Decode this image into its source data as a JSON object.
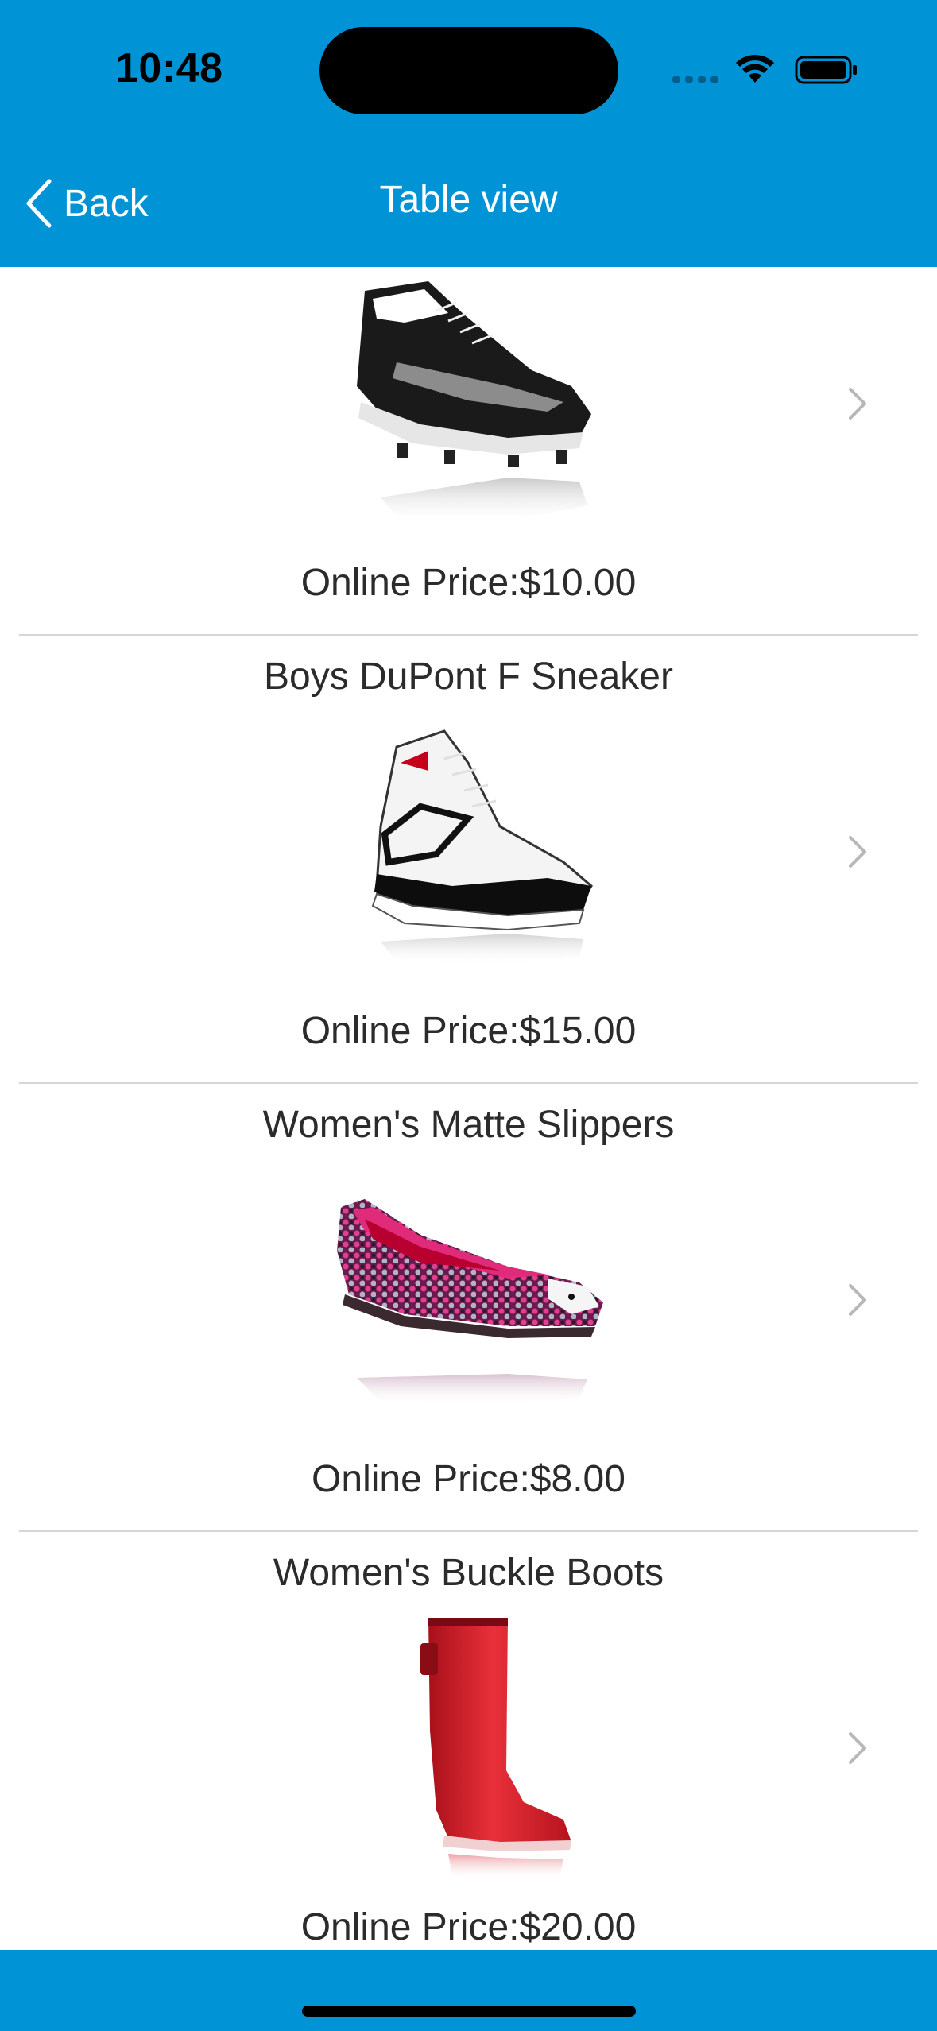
{
  "status_bar": {
    "time": "10:48",
    "wifi_icon": "wifi-icon",
    "battery_icon": "battery-icon"
  },
  "nav": {
    "back_label": "Back",
    "back_icon": "chevron-left-icon",
    "title": "Table view"
  },
  "theme": {
    "bar_color": "#0094d6",
    "text_color": "#2b2b2b",
    "separator_color": "#d6d6d6"
  },
  "products": [
    {
      "name": "",
      "price": "Online Price:$10.00",
      "image": "black-white-cleat-shoe-image"
    },
    {
      "name": "Boys DuPont F Sneaker",
      "price": "Online Price:$15.00",
      "image": "white-black-high-top-sneaker-image"
    },
    {
      "name": "Women's Matte Slippers",
      "price": "Online Price:$8.00",
      "image": "pink-sequin-flat-shoe-image"
    },
    {
      "name": "Women's Buckle Boots",
      "price": "Online Price:$20.00",
      "image": "red-rain-boot-image"
    }
  ]
}
